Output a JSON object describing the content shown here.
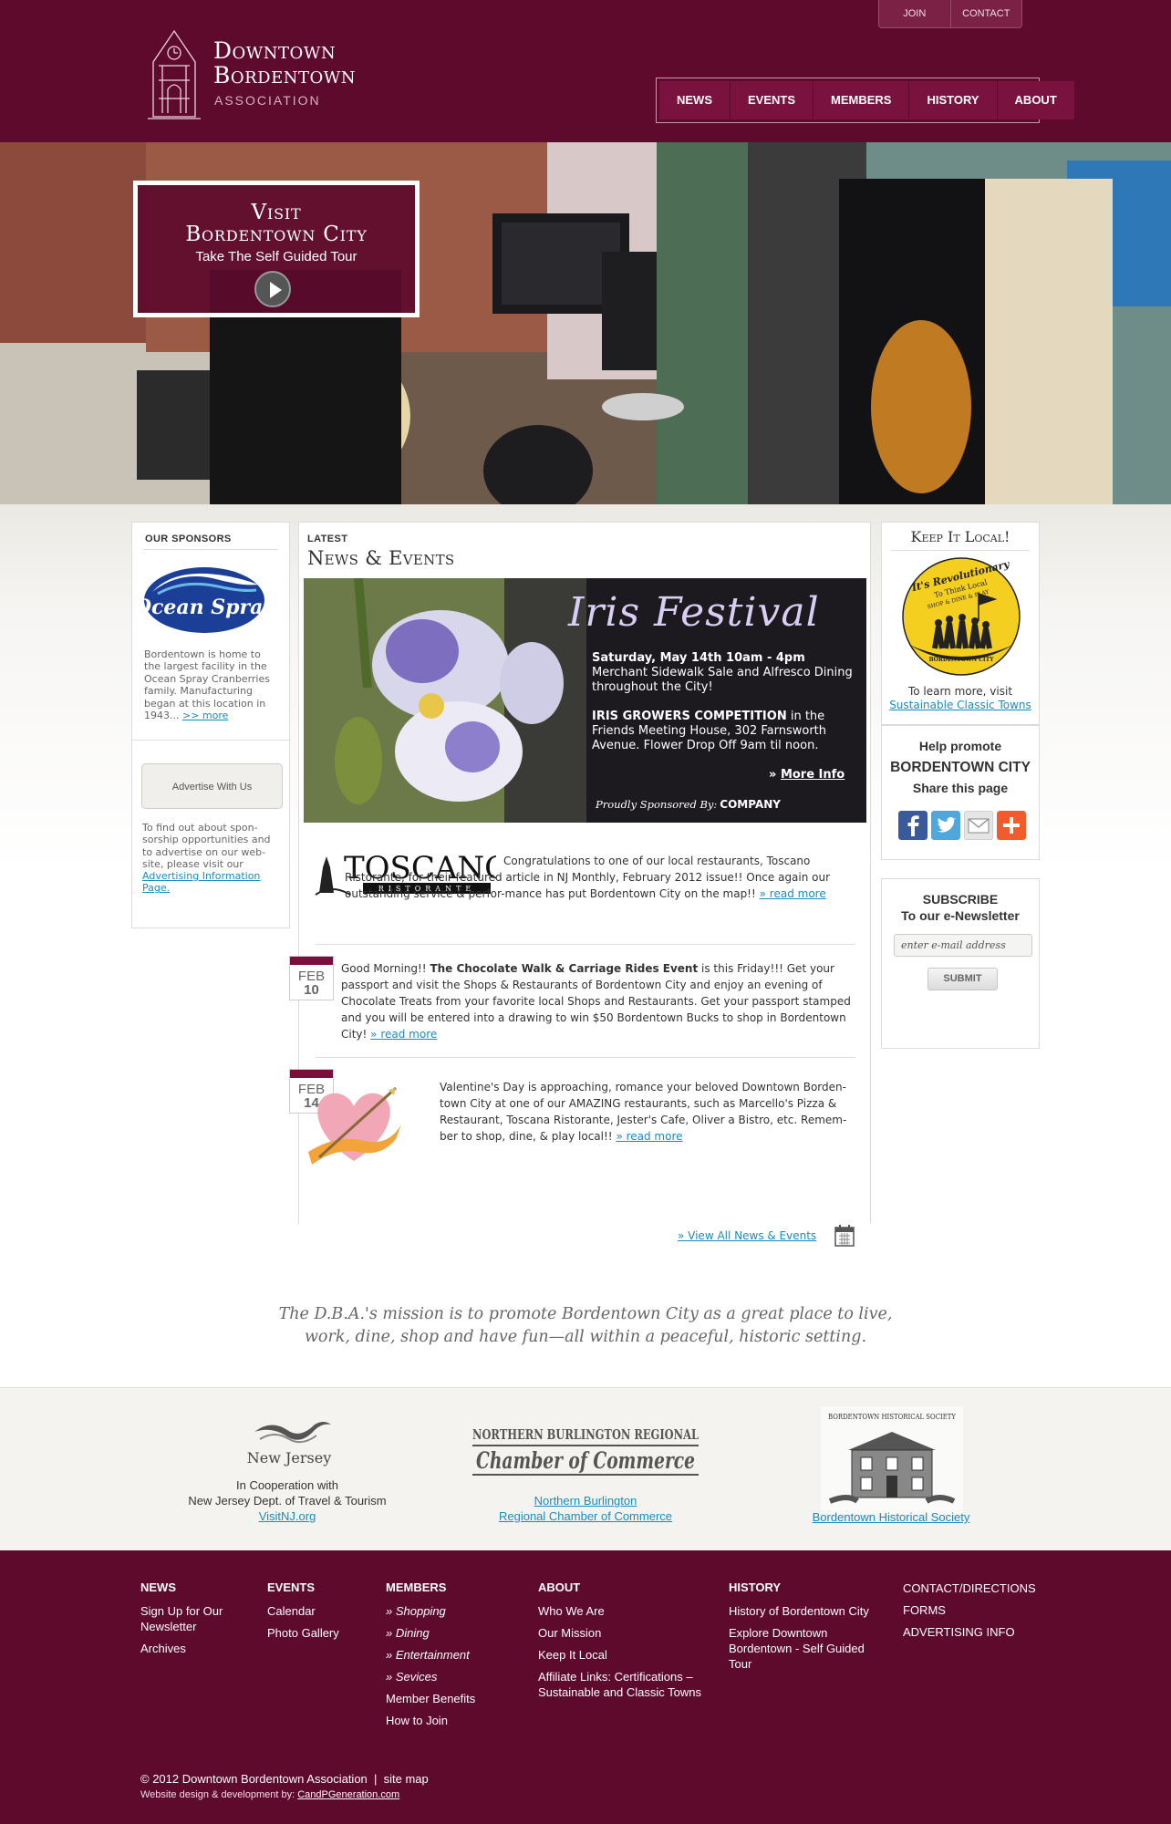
{
  "header": {
    "logo_line1": "Downtown",
    "logo_line2": "Bordentown",
    "logo_sub": "ASSOCIATION",
    "top_links": [
      "JOIN",
      "CONTACT"
    ],
    "nav": [
      "NEWS",
      "EVENTS",
      "MEMBERS",
      "HISTORY",
      "ABOUT"
    ]
  },
  "hero": {
    "title_line1": "Visit",
    "title_line2": "Bordentown City",
    "subtitle": "Take The Self Guided Tour"
  },
  "sidebar": {
    "sponsors_heading": "OUR SPONSORS",
    "sponsor_logo_text": "Ocean Spray",
    "sponsor_text": "Bordentown is home to the largest facility in the Ocean Spray Cranberries family. Manufacturing began at this location in 1943...",
    "sponsor_more": ">> more",
    "advertise_button": "Advertise With Us",
    "advertise_text": "To find out about spon-sorship opportunities and to advertise on our web-site, please visit our",
    "advertise_link": "Advertising Information Page."
  },
  "news": {
    "latest_label": "LATEST",
    "title": "News & Events",
    "feature": {
      "title": "Iris Festival",
      "date": "Saturday, May 14th 10am - 4pm",
      "date_desc": "Merchant Sidewalk Sale and Alfresco Dining throughout the City!",
      "competition_bold": "IRIS GROWERS COMPETITION",
      "competition_rest": " in the Friends Meeting House, 302 Farnsworth Avenue. Flower Drop Off 9am til noon.",
      "more_prefix": "» ",
      "more_label": "More Info",
      "sponsor_label": "Proudly Sponsored By:",
      "sponsor_company": "COMPANY"
    },
    "toscano_logo_text": "TOSCANO",
    "toscano_logo_sub": "RISTORANTE",
    "toscano_text": "Congratulations to one of our local restaurants, Toscano Ristorante, for their featured article in NJ Monthly, February 2012 issue!! Once again our outstanding service & perfor-mance has put Bordentown City on the map!!",
    "read_more": "» read more",
    "feb10": {
      "month": "FEB",
      "day": "10",
      "text_before": "Good Morning!! ",
      "text_bold": "The Chocolate Walk & Carriage Rides Event",
      "text_after": " is this Friday!!! Get your passport and visit the Shops & Restaurants of Bordentown City and enjoy an evening of Chocolate Treats from your favorite local Shops and Restaurants. Get your passport stamped and you will be entered into a drawing to win $50 Bordentown Bucks to shop in Bordentown City!"
    },
    "feb14": {
      "month": "FEB",
      "day": "14",
      "text": "Valentine's Day is approaching, romance your beloved Downtown Borden-town City at one of our AMAZING restaurants, such as Marcello's Pizza & Restaurant, Toscana Ristorante, Jester's Cafe, Oliver a Bistro, etc. Remem-ber to shop, dine, & play local!!"
    },
    "view_all": "» View All News & Events"
  },
  "right": {
    "keep_title": "Keep It Local!",
    "badge_text1": "It's Revolutionary",
    "badge_text2": "To Think Local",
    "badge_text3": "SHOP & DINE & PLAY",
    "badge_text4": "BORDENTOWN CITY",
    "keep_text": "To learn more, visit",
    "keep_link": "Sustainable Classic Towns",
    "share_line1": "Help promote",
    "share_line2": "BORDENTOWN CITY",
    "share_line3": "Share this page",
    "subscribe_line1": "SUBSCRIBE",
    "subscribe_line2": "To our e-Newsletter",
    "email_placeholder": "enter e-mail address",
    "submit_label": "SUBMIT"
  },
  "mission": {
    "line1": "The D.B.A.'s mission is to promote Bordentown City as a great place to live,",
    "line2": "work, dine, shop and have fun—all within a peaceful, historic setting."
  },
  "partners": {
    "nj_logo_text": "New Jersey",
    "nj_line1": "In Cooperation with",
    "nj_line2": "New Jersey Dept. of Travel & Tourism",
    "nj_link": "VisitNJ.org",
    "chamber_logo_line1": "NORTHERN BURLINGTON REGIONAL",
    "chamber_logo_line2": "Chamber of Commerce",
    "chamber_link_line1": "Northern Burlington",
    "chamber_link_line2": "Regional Chamber of Commerce",
    "hist_logo_text": "BORDENTOWN HISTORICAL SOCIETY",
    "hist_link": "Bordentown Historical Society"
  },
  "footer": {
    "news": {
      "heading": "NEWS",
      "items": [
        "Sign Up for Our Newsletter",
        "Archives"
      ]
    },
    "events": {
      "heading": "EVENTS",
      "items": [
        "Calendar",
        "Photo Gallery"
      ]
    },
    "members": {
      "heading": "MEMBERS",
      "sub_items": [
        "Shopping",
        "Dining",
        "Entertainment",
        "Sevices"
      ],
      "items": [
        "Member Benefits",
        "How to Join"
      ]
    },
    "about": {
      "heading": "ABOUT",
      "items": [
        "Who We Are",
        "Our Mission",
        "Keep It Local",
        "Affiliate Links: Certifications – Sustainable and Classic Towns"
      ]
    },
    "history": {
      "heading": "HISTORY",
      "items": [
        "History of Bordentown City",
        "Explore Downtown Bordentown - Self Guided Tour"
      ]
    },
    "extra": {
      "items": [
        "CONTACT/DIRECTIONS",
        "FORMS",
        "ADVERTISING INFO"
      ]
    },
    "copyright": "© 2012 Downtown Bordentown Association  |  site map",
    "credit_prefix": "Website design & development by: ",
    "credit_link": "CandPGeneration.com"
  },
  "colors": {
    "brand": "#5e0a2c",
    "link": "#1a8cc0"
  }
}
